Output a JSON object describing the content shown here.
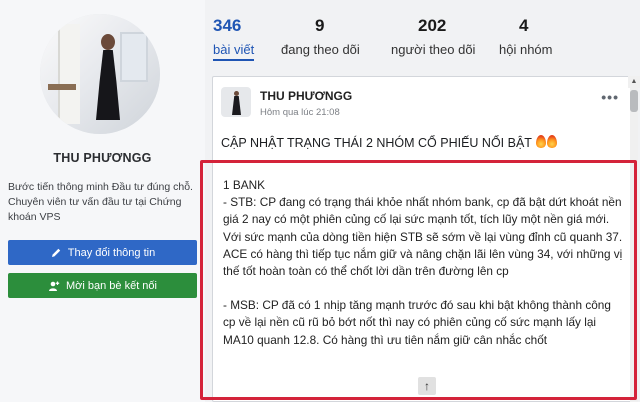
{
  "profile": {
    "name": "THU PHƯƠNGG",
    "bio": "Bước tiến thông minh Đầu tư đúng chỗ. Chuyên viên tư vấn đầu tư tại Chứng khoán VPS",
    "edit_button": "Thay đổi thông tin",
    "invite_button": "Mời bạn bè kết nối"
  },
  "stats": [
    {
      "num": "346",
      "label": "bài viết"
    },
    {
      "num": "9",
      "label": "đang theo dõi"
    },
    {
      "num": "202",
      "label": "người theo dõi"
    },
    {
      "num": "4",
      "label": "hội nhóm"
    }
  ],
  "post": {
    "author": "THU PHƯƠNGG",
    "time": "Hôm qua lúc 21:08",
    "headline": "CẬP NHẬT TRẠNG THÁI 2 NHÓM CỔ PHIẾU NỔI BẬT",
    "paragraphs": [
      "1 BANK",
      "- STB: CP đang có trạng thái khỏe nhất nhóm bank, cp đã bật dứt khoát nền giá 2 nay có một phiên củng cố lại sức mạnh tốt, tích lũy một nền giá mới. Với sức mạnh của dòng tiền hiện STB sẽ sớm về lại vùng đỉnh cũ quanh 37. ACE có hàng thì tiếp tục nắm giữ và nâng chặn lãi lên vùng 34, với những vị thế tốt hoàn toàn có thể chốt lời dần trên đường lên cp",
      "",
      "- MSB: CP đã có 1 nhịp tăng mạnh trước đó sau khi bật không thành công cp về lại nền cũ rũ bỏ bớt nốt thì nay có phiên củng cố sức mạnh lấy lại MA10 quanh 12.8. Có hàng thì ưu tiên nắm giữ cân nhắc chốt"
    ]
  },
  "colors": {
    "accent": "#1f55b4",
    "edit_button": "#2f68c6",
    "invite_button": "#2c8e3c",
    "highlight": "#d4233a"
  }
}
